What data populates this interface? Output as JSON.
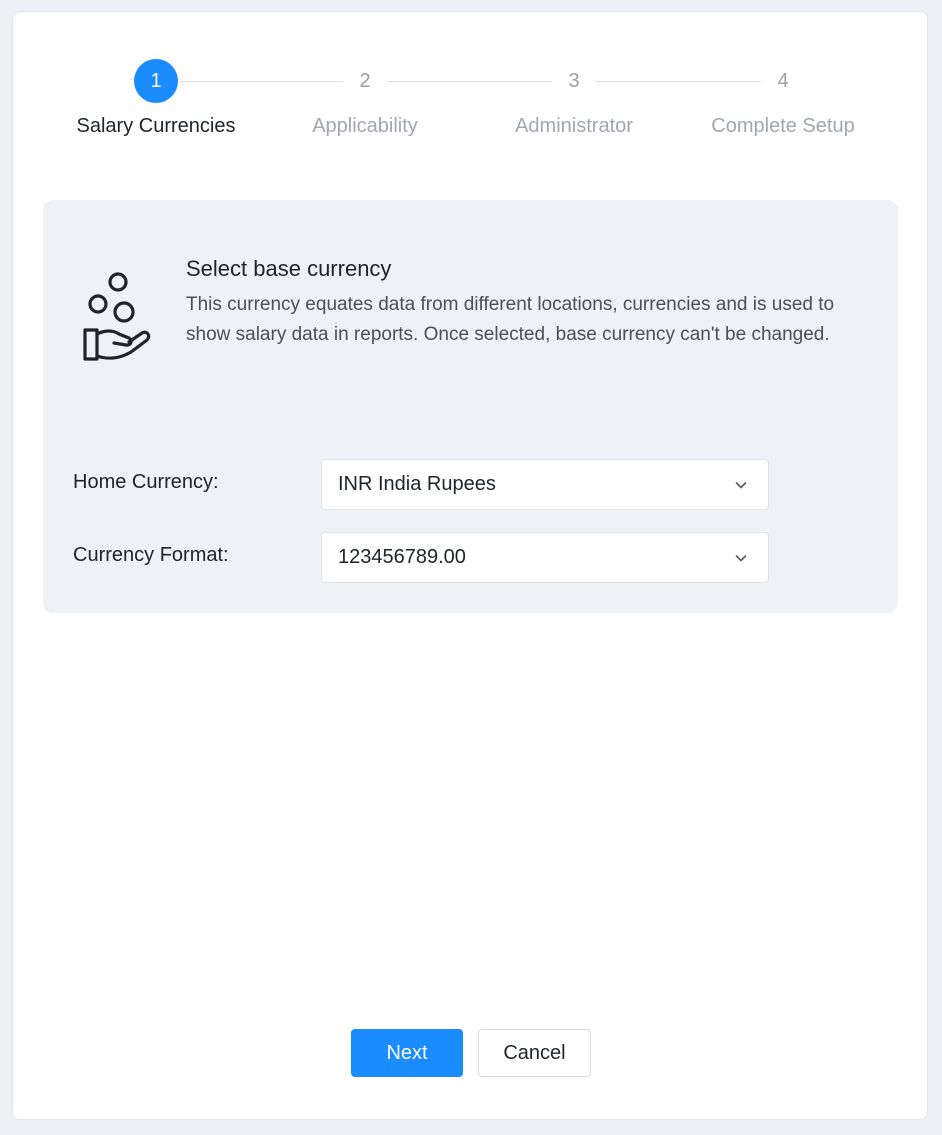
{
  "stepper": {
    "steps": [
      {
        "number": "1",
        "label": "Salary Currencies",
        "active": true
      },
      {
        "number": "2",
        "label": "Applicability",
        "active": false
      },
      {
        "number": "3",
        "label": "Administrator",
        "active": false
      },
      {
        "number": "4",
        "label": "Complete Setup",
        "active": false
      }
    ]
  },
  "section": {
    "icon": "coins-hand-icon",
    "title": "Select base currency",
    "description": "This currency equates data from different locations, currencies and is used to show salary data in reports. Once selected, base currency can't be changed."
  },
  "form": {
    "home_currency_label": "Home Currency:",
    "home_currency_value": "INR India Rupees",
    "currency_format_label": "Currency Format:",
    "currency_format_value": "123456789.00"
  },
  "actions": {
    "next_label": "Next",
    "cancel_label": "Cancel"
  },
  "colors": {
    "accent": "#1a8cff",
    "page_bg": "#edf1f6",
    "panel_bg": "#eef1f5"
  }
}
